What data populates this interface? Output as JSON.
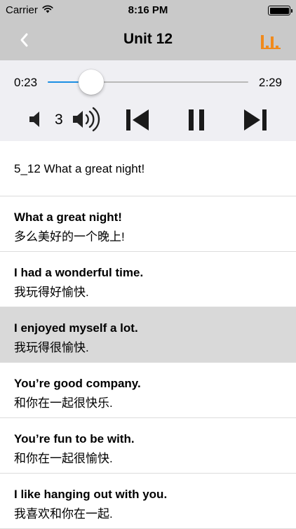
{
  "status_bar": {
    "carrier": "Carrier",
    "time": "8:16 PM",
    "wifi_icon": "wifi-icon",
    "battery_icon": "battery-icon"
  },
  "nav": {
    "title": "Unit 12",
    "back_icon": "chevron-left-icon",
    "right_icon": "bar-chart-icon",
    "accent_color": "#f08a1c"
  },
  "player": {
    "current_time": "0:23",
    "total_time": "2:29",
    "progress": 0.154,
    "progress_color": "#1b8fe3",
    "volume": "3",
    "icons": [
      "volume-down-icon",
      "volume-up-icon",
      "skip-previous-icon",
      "pause-icon",
      "skip-next-icon"
    ]
  },
  "list": {
    "header": "5_12 What a great night!",
    "items": [
      {
        "en": "What a great night!",
        "zh": "多么美好的一个晚上!",
        "selected": false
      },
      {
        "en": "I had a wonderful time.",
        "zh": "我玩得好愉快.",
        "selected": false
      },
      {
        "en": "I enjoyed myself a lot.",
        "zh": "我玩得很愉快.",
        "selected": true
      },
      {
        "en": "You’re good company.",
        "zh": "和你在一起很快乐.",
        "selected": false
      },
      {
        "en": "You’re fun to be with.",
        "zh": "和你在一起很愉快.",
        "selected": false
      },
      {
        "en": "I like hanging out with you.",
        "zh": "我喜欢和你在一起.",
        "selected": false
      }
    ]
  }
}
